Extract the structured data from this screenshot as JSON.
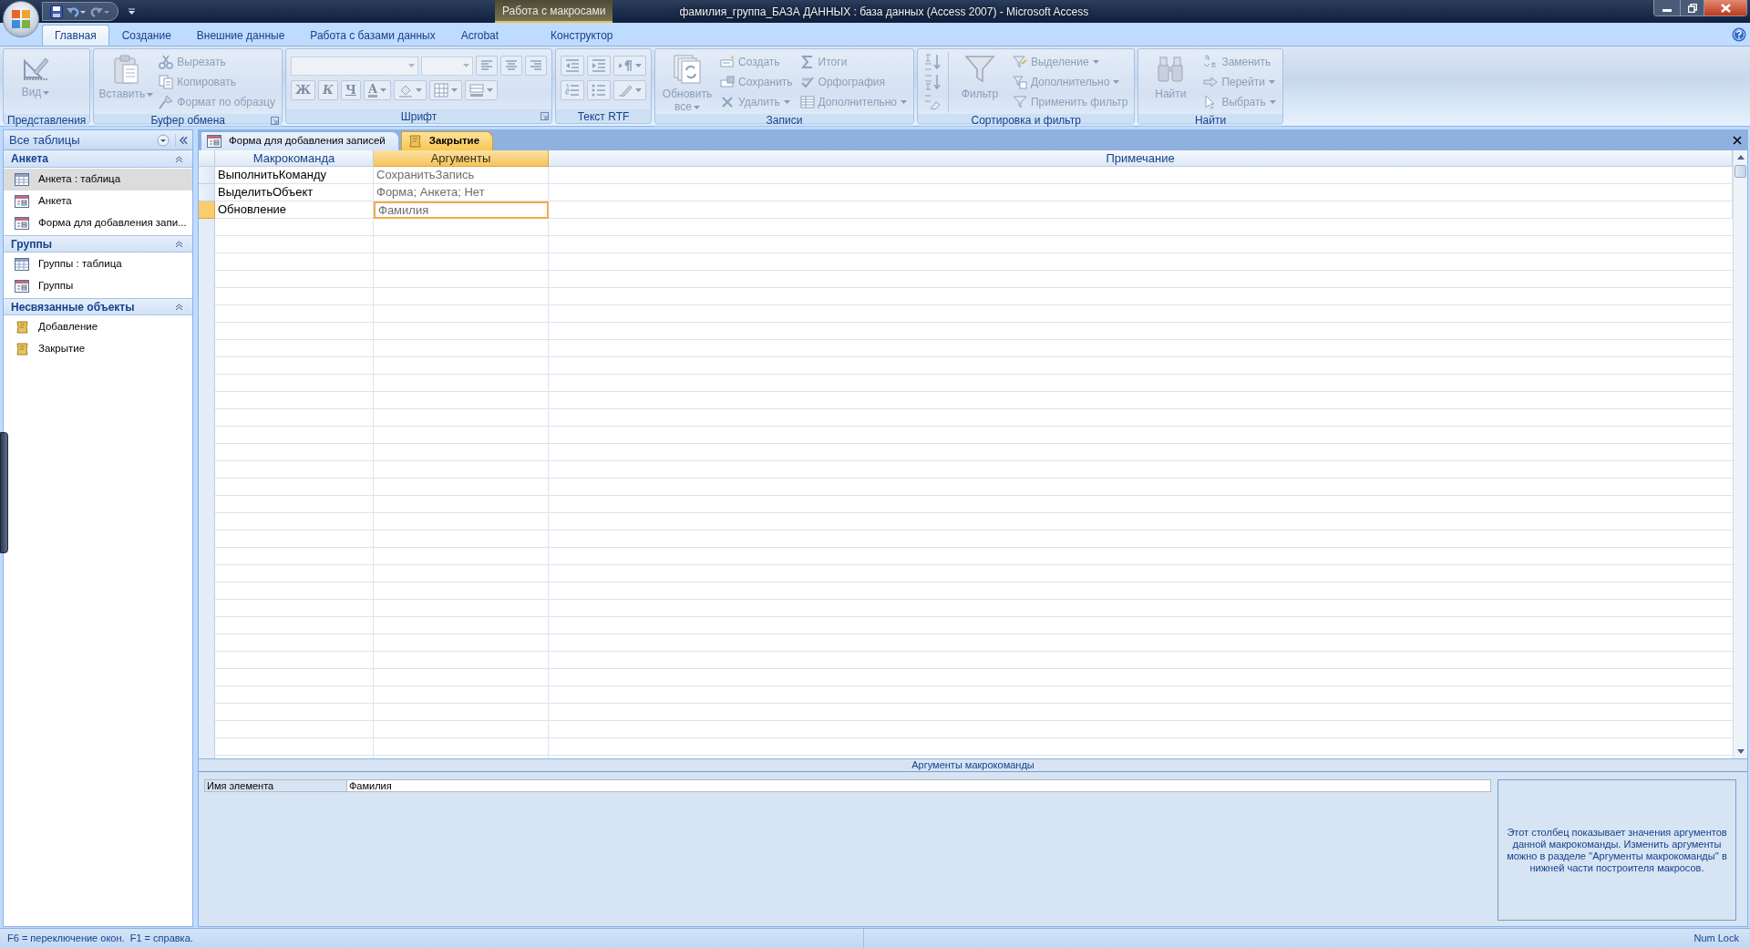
{
  "title_bar": {
    "contextual_label": "Работа с макросами",
    "title": "фамилия_группа_БАЗА ДАННЫХ : база данных (Access 2007)  -  Microsoft Access"
  },
  "ribbon_tabs": [
    {
      "label": "Главная",
      "selected": true,
      "kind": "normal"
    },
    {
      "label": "Создание",
      "selected": false,
      "kind": "normal"
    },
    {
      "label": "Внешние данные",
      "selected": false,
      "kind": "normal"
    },
    {
      "label": "Работа с базами данных",
      "selected": false,
      "kind": "normal"
    },
    {
      "label": "Acrobat",
      "selected": false,
      "kind": "normal"
    },
    {
      "label": "Конструктор",
      "selected": false,
      "kind": "contextual"
    }
  ],
  "ribbon_groups": [
    {
      "label": "Представления",
      "launcher": false,
      "items": [
        {
          "kind": "large",
          "label": "Вид",
          "dropdown": true
        }
      ]
    },
    {
      "label": "Буфер обмена",
      "launcher": true,
      "items": [
        {
          "kind": "large",
          "label": "Вставить",
          "dropdown": true
        },
        {
          "kind": "small",
          "label": "Вырезать",
          "dropdown": false
        },
        {
          "kind": "small",
          "label": "Копировать",
          "dropdown": false
        },
        {
          "kind": "small",
          "label": "Формат по образцу",
          "dropdown": false
        }
      ]
    },
    {
      "label": "Шрифт",
      "launcher": true,
      "rows": [
        [
          {
            "kind": "combo"
          },
          {
            "kind": "combo"
          },
          {
            "kind": "icon",
            "dropdown": false
          },
          {
            "kind": "icon",
            "dropdown": false
          },
          {
            "kind": "icon",
            "dropdown": false
          }
        ],
        [
          {
            "kind": "glyph",
            "label": "Ж",
            "dropdown": false
          },
          {
            "kind": "glyph",
            "label": "К",
            "dropdown": false
          },
          {
            "kind": "glyph",
            "label": "Ч",
            "dropdown": false
          },
          {
            "kind": "glyph",
            "label": "A",
            "dropdown": true
          },
          {
            "kind": "icon",
            "dropdown": true
          },
          {
            "kind": "icon",
            "dropdown": true
          },
          {
            "kind": "icon",
            "dropdown": true
          }
        ]
      ]
    },
    {
      "label": "Текст RTF",
      "launcher": false,
      "rows": [
        [
          {
            "kind": "icon",
            "dropdown": false
          },
          {
            "kind": "icon",
            "dropdown": false
          },
          {
            "kind": "icon",
            "dropdown": true
          }
        ],
        [
          {
            "kind": "icon",
            "dropdown": false
          },
          {
            "kind": "icon",
            "dropdown": false
          },
          {
            "kind": "icon",
            "dropdown": true
          }
        ]
      ]
    },
    {
      "label": "Записи",
      "launcher": false,
      "items": [
        {
          "kind": "large",
          "label": "Обновить все",
          "dropdown": true
        },
        {
          "kind": "small",
          "label": "Создать",
          "dropdown": false
        },
        {
          "kind": "small",
          "label": "Сохранить",
          "dropdown": false
        },
        {
          "kind": "small",
          "label": "Удалить",
          "dropdown": true
        },
        {
          "kind": "small",
          "label": "Итоги",
          "dropdown": false
        },
        {
          "kind": "small",
          "label": "Орфография",
          "dropdown": false
        },
        {
          "kind": "small",
          "label": "Дополнительно",
          "dropdown": true
        }
      ]
    },
    {
      "label": "Сортировка и фильтр",
      "launcher": false,
      "items": [
        {
          "kind": "icon",
          "dropdown": false
        },
        {
          "kind": "icon",
          "dropdown": false
        },
        {
          "kind": "icon",
          "dropdown": false
        },
        {
          "kind": "large",
          "label": "Фильтр",
          "dropdown": false
        },
        {
          "kind": "small",
          "label": "Выделение",
          "dropdown": true
        },
        {
          "kind": "small",
          "label": "Дополнительно",
          "dropdown": true
        },
        {
          "kind": "small",
          "label": "Применить фильтр",
          "dropdown": false
        }
      ]
    },
    {
      "label": "Найти",
      "launcher": false,
      "items": [
        {
          "kind": "large",
          "label": "Найти",
          "dropdown": false
        },
        {
          "kind": "small",
          "label": "Заменить",
          "dropdown": false
        },
        {
          "kind": "small",
          "label": "Перейти",
          "dropdown": true
        },
        {
          "kind": "small",
          "label": "Выбрать",
          "dropdown": true
        }
      ]
    }
  ],
  "nav_pane": {
    "title": "Все таблицы",
    "groups": [
      {
        "label": "Анкета",
        "expanded": true,
        "items": [
          {
            "label": "Анкета : таблица",
            "kind": "table",
            "selected": true
          },
          {
            "label": "Анкета",
            "kind": "form",
            "selected": false
          },
          {
            "label": "Форма для добавления запи...",
            "kind": "form",
            "selected": false
          }
        ]
      },
      {
        "label": "Группы",
        "expanded": true,
        "items": [
          {
            "label": "Группы : таблица",
            "kind": "table",
            "selected": false
          },
          {
            "label": "Группы",
            "kind": "form",
            "selected": false
          }
        ]
      },
      {
        "label": "Несвязанные объекты",
        "expanded": true,
        "items": [
          {
            "label": "Добавление",
            "kind": "macro",
            "selected": false
          },
          {
            "label": "Закрытие",
            "kind": "macro",
            "selected": false
          }
        ]
      }
    ]
  },
  "doc_tabs": [
    {
      "label": "Форма для добавления записей",
      "kind": "form",
      "selected": false
    },
    {
      "label": "Закрытие",
      "kind": "macro",
      "selected": true
    }
  ],
  "macro_grid": {
    "columns": [
      {
        "label": "Макрокоманда",
        "selected": false
      },
      {
        "label": "Аргументы",
        "selected": true
      },
      {
        "label": "Примечание",
        "selected": false
      }
    ],
    "rows": [
      {
        "action": "ВыполнитьКоманду",
        "arguments": "СохранитьЗапись",
        "selected": false
      },
      {
        "action": "ВыделитьОбъект",
        "arguments": "Форма; Анкета; Нет",
        "selected": false
      },
      {
        "action": "Обновление",
        "arguments": "Фамилия",
        "selected": true
      }
    ]
  },
  "arguments_pane": {
    "title": "Аргументы макрокоманды",
    "fields": [
      {
        "label": "Имя элемента",
        "value": "Фамилия"
      }
    ],
    "help": "Этот столбец показывает значения аргументов данной макрокоманды. Изменить аргументы можно в разделе ''Аргументы макрокоманды'' в нижней части построителя макросов."
  },
  "status_bar": {
    "message": "F6 = переключение окон.  F1 = справка.",
    "indicator": "Num Lock"
  }
}
